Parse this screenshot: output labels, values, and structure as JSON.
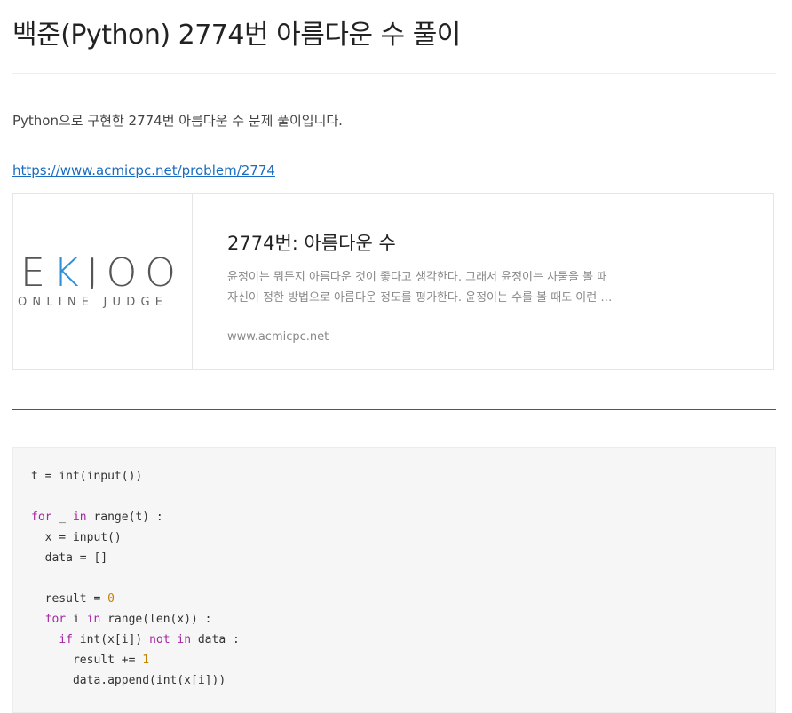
{
  "post": {
    "title": "백준(Python) 2774번 아름다운 수 풀이",
    "intro": "Python으로 구현한 2774번 아름다운 수 문제 풀이입니다.",
    "link": "https://www.acmicpc.net/problem/2774"
  },
  "card": {
    "logo_text": "BAEKJOON",
    "logo_visible": "EKJOO",
    "logo_sub": "ONLINE JUDGE",
    "logo_accent": "#2f8fd8",
    "title": "2774번: 아름다운 수",
    "desc_line1": "윤정이는 뭐든지 아름다운 것이 좋다고 생각한다. 그래서 윤정이는 사물을 볼 때",
    "desc_line2": "자신이 정한 방법으로 아름다운 정도를 평가한다. 윤정이는 수를 볼 때도 이런 …",
    "domain": "www.acmicpc.net"
  },
  "code": {
    "lines": [
      [
        {
          "t": "t = int(input())"
        }
      ],
      [],
      [
        {
          "t": "for",
          "c": "kw"
        },
        {
          "t": " _ "
        },
        {
          "t": "in",
          "c": "kw"
        },
        {
          "t": " range(t) :"
        }
      ],
      [
        {
          "t": "  x = input()"
        }
      ],
      [
        {
          "t": "  data = []"
        }
      ],
      [],
      [
        {
          "t": "  result = "
        },
        {
          "t": "0",
          "c": "num"
        }
      ],
      [
        {
          "t": "  "
        },
        {
          "t": "for",
          "c": "kw"
        },
        {
          "t": " i "
        },
        {
          "t": "in",
          "c": "kw"
        },
        {
          "t": " range(len(x)) :"
        }
      ],
      [
        {
          "t": "    "
        },
        {
          "t": "if",
          "c": "kw"
        },
        {
          "t": " int(x[i]) "
        },
        {
          "t": "not",
          "c": "kw"
        },
        {
          "t": " "
        },
        {
          "t": "in",
          "c": "kw"
        },
        {
          "t": " data :"
        }
      ],
      [
        {
          "t": "      result += "
        },
        {
          "t": "1",
          "c": "num"
        }
      ],
      [
        {
          "t": "      data.append(int(x[i]))"
        }
      ]
    ]
  }
}
